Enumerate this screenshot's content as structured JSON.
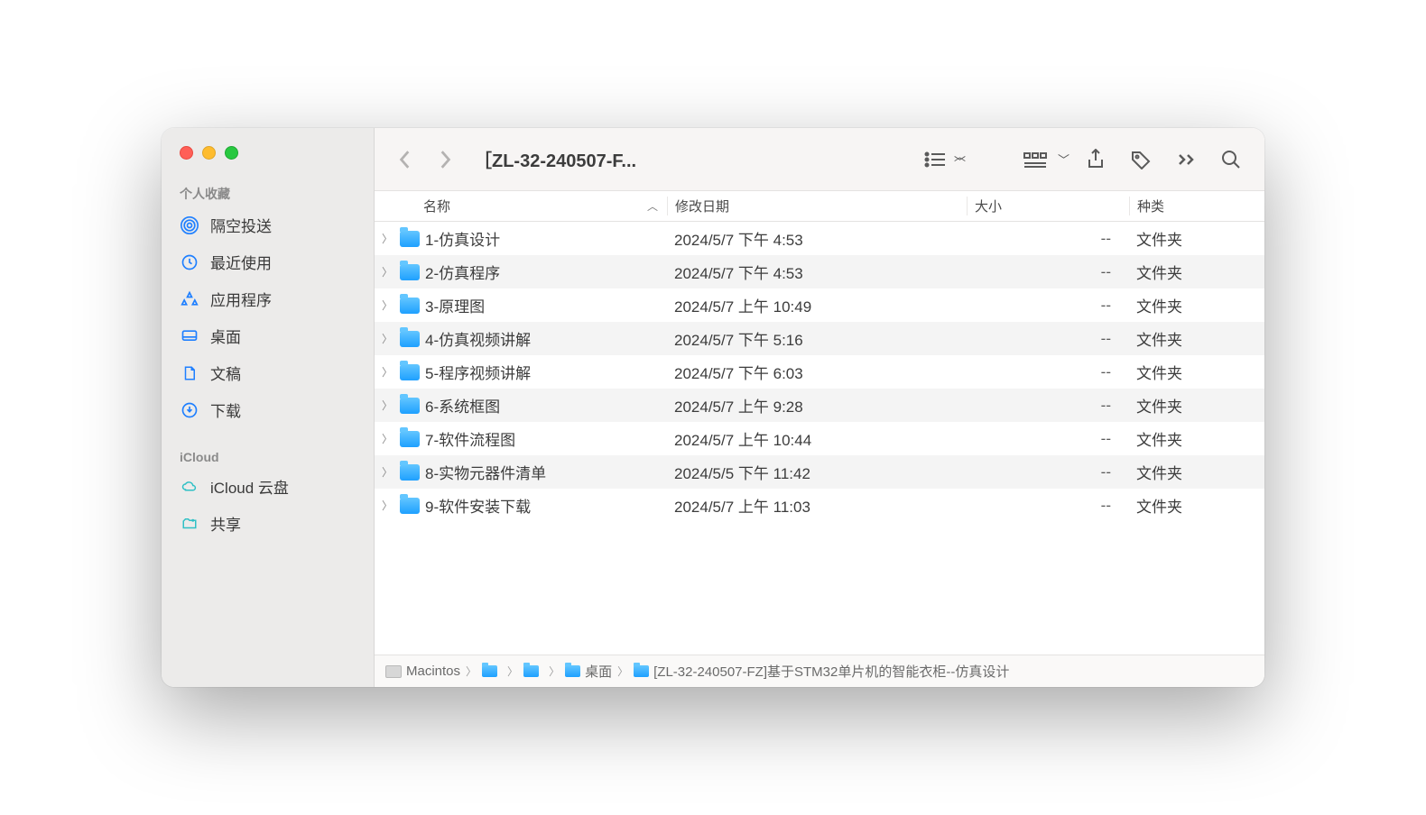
{
  "window": {
    "title": "［ZL-32-240507-F..."
  },
  "sidebar": {
    "sections": [
      {
        "label": "个人收藏",
        "items": [
          {
            "icon": "airdrop",
            "label": "隔空投送"
          },
          {
            "icon": "clock",
            "label": "最近使用"
          },
          {
            "icon": "apps",
            "label": "应用程序"
          },
          {
            "icon": "desktop",
            "label": "桌面"
          },
          {
            "icon": "doc",
            "label": "文稿"
          },
          {
            "icon": "download",
            "label": "下载"
          }
        ]
      },
      {
        "label": "iCloud",
        "items": [
          {
            "icon": "cloud",
            "label": "iCloud 云盘"
          },
          {
            "icon": "shared",
            "label": "共享"
          }
        ]
      }
    ]
  },
  "columns": {
    "name": "名称",
    "date": "修改日期",
    "size": "大小",
    "kind": "种类"
  },
  "rows": [
    {
      "name": "1-仿真设计",
      "date": "2024/5/7 下午 4:53",
      "size": "--",
      "kind": "文件夹"
    },
    {
      "name": "2-仿真程序",
      "date": "2024/5/7 下午 4:53",
      "size": "--",
      "kind": "文件夹"
    },
    {
      "name": "3-原理图",
      "date": "2024/5/7 上午 10:49",
      "size": "--",
      "kind": "文件夹"
    },
    {
      "name": "4-仿真视频讲解",
      "date": "2024/5/7 下午 5:16",
      "size": "--",
      "kind": "文件夹"
    },
    {
      "name": "5-程序视频讲解",
      "date": "2024/5/7 下午 6:03",
      "size": "--",
      "kind": "文件夹"
    },
    {
      "name": "6-系统框图",
      "date": "2024/5/7 上午 9:28",
      "size": "--",
      "kind": "文件夹"
    },
    {
      "name": "7-软件流程图",
      "date": "2024/5/7 上午 10:44",
      "size": "--",
      "kind": "文件夹"
    },
    {
      "name": "8-实物元器件清单",
      "date": "2024/5/5 下午 11:42",
      "size": "--",
      "kind": "文件夹"
    },
    {
      "name": "9-软件安装下载",
      "date": "2024/5/7 上午 11:03",
      "size": "--",
      "kind": "文件夹"
    }
  ],
  "path": {
    "segments": [
      {
        "type": "disk",
        "label": "Macintos"
      },
      {
        "type": "folder",
        "label": ""
      },
      {
        "type": "folder",
        "label": ""
      },
      {
        "type": "folder",
        "label": "桌面"
      },
      {
        "type": "folder",
        "label": "[ZL-32-240507-FZ]基于STM32单片机的智能衣柜--仿真设计"
      }
    ]
  }
}
